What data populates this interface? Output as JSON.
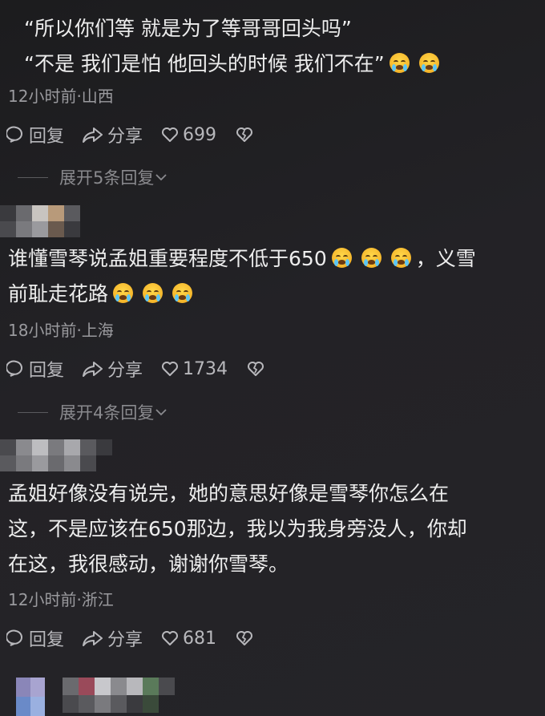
{
  "comments": [
    {
      "line1": "“所以你们等 就是为了等哥哥回头吗”",
      "line2": "“不是 我们是怕 他回头的时候 我们不在”",
      "time_location": "12小时前·山西",
      "reply_label": "回复",
      "share_label": "分享",
      "likes": "699",
      "expand_label": "展开5条回复"
    },
    {
      "line1": "谁懂雪琴说孟姐重要程度不低于650",
      "line1b": "，义雪",
      "line2": "前耻走花路",
      "time_location": "18小时前·上海",
      "reply_label": "回复",
      "share_label": "分享",
      "likes": "1734",
      "expand_label": "展开4条回复"
    },
    {
      "line1": "孟姐好像没有说完，她的意思好像是雪琴你怎么在",
      "line2": "这，不是应该在650那边，我以为我身旁没人，你却",
      "line3": "在这，我很感动，谢谢你雪琴。",
      "time_location": "12小时前·浙江",
      "reply_label": "回复",
      "share_label": "分享",
      "likes": "681"
    }
  ],
  "icons": {
    "reply": "reply-bubble-icon",
    "share": "share-arrow-icon",
    "like": "heart-icon",
    "dislike": "broken-heart-icon",
    "expand": "chevron-down-icon",
    "emoji": "loudly-crying-face-icon"
  }
}
